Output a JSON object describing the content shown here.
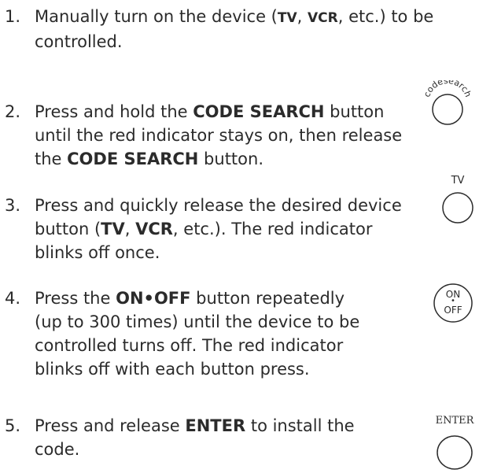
{
  "steps": [
    {
      "number": "1.",
      "parts": [
        {
          "t": "Manually turn on the device ("
        },
        {
          "t": "TV",
          "b": "small"
        },
        {
          "t": ", "
        },
        {
          "t": "VCR",
          "b": "small"
        },
        {
          "t": ", etc.) to be controlled."
        }
      ]
    },
    {
      "number": "2.",
      "parts": [
        {
          "t": "Press and hold the "
        },
        {
          "t": "CODE SEARCH",
          "b": "big"
        },
        {
          "t": " button until the red indicator stays on, then release the "
        },
        {
          "t": "CODE SEARCH",
          "b": "big"
        },
        {
          "t": " button."
        }
      ],
      "button": {
        "icon": "code-search-button-icon",
        "label": "codesearch"
      }
    },
    {
      "number": "3.",
      "parts": [
        {
          "t": "Press and quickly release the desired device button ("
        },
        {
          "t": "TV",
          "b": "big"
        },
        {
          "t": ", "
        },
        {
          "t": "VCR",
          "b": "big"
        },
        {
          "t": ", etc.). The red indicator blinks off once."
        }
      ],
      "button": {
        "icon": "tv-button-icon",
        "label": "TV"
      }
    },
    {
      "number": "4.",
      "parts": [
        {
          "t": "Press the "
        },
        {
          "t": "ON•OFF",
          "b": "big"
        },
        {
          "t": " button repeatedly (up to 300 times) until the device to be controlled turns off. The red indicator blinks off with each button press."
        }
      ],
      "button": {
        "icon": "on-off-button-icon",
        "label_top": "ON",
        "label_dot": "•",
        "label_bottom": "OFF"
      }
    },
    {
      "number": "5.",
      "parts": [
        {
          "t": "Press and release "
        },
        {
          "t": "ENTER",
          "b": "big"
        },
        {
          "t": " to install the code."
        }
      ],
      "button": {
        "icon": "enter-button-icon",
        "label": "ENTER"
      }
    }
  ]
}
